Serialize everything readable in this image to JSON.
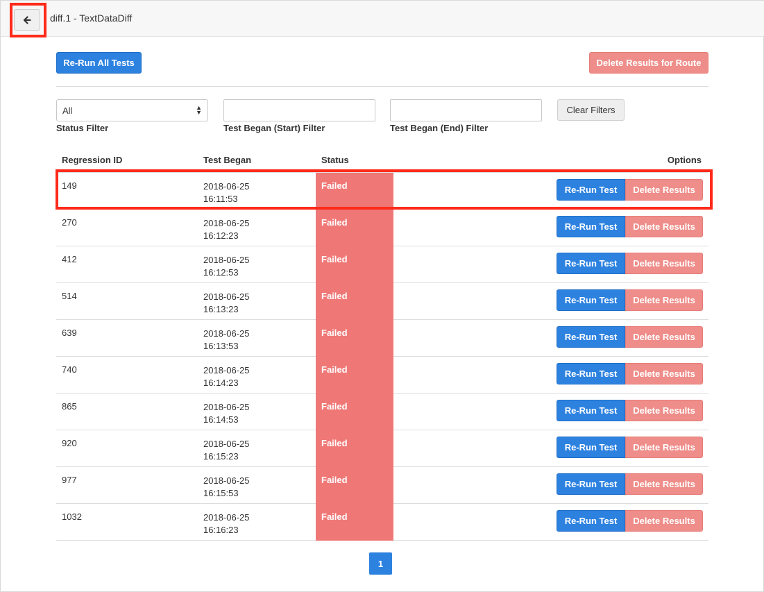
{
  "header": {
    "back_icon": "arrow-left-icon",
    "title": "diff.1 - TextDataDiff"
  },
  "toolbar": {
    "rerun_all_label": "Re-Run All Tests",
    "delete_route_label": "Delete Results for Route"
  },
  "filters": {
    "status_value": "All",
    "status_label": "Status Filter",
    "start_value": "",
    "start_label": "Test Began (Start) Filter",
    "end_value": "",
    "end_label": "Test Began (End) Filter",
    "clear_label": "Clear Filters"
  },
  "table": {
    "headers": {
      "id": "Regression ID",
      "began": "Test Began",
      "status": "Status",
      "options": "Options"
    },
    "rerun_label": "Re-Run Test",
    "delete_label": "Delete Results",
    "rows": [
      {
        "id": "149",
        "date": "2018-06-25",
        "time": "16:11:53",
        "status": "Failed"
      },
      {
        "id": "270",
        "date": "2018-06-25",
        "time": "16:12:23",
        "status": "Failed"
      },
      {
        "id": "412",
        "date": "2018-06-25",
        "time": "16:12:53",
        "status": "Failed"
      },
      {
        "id": "514",
        "date": "2018-06-25",
        "time": "16:13:23",
        "status": "Failed"
      },
      {
        "id": "639",
        "date": "2018-06-25",
        "time": "16:13:53",
        "status": "Failed"
      },
      {
        "id": "740",
        "date": "2018-06-25",
        "time": "16:14:23",
        "status": "Failed"
      },
      {
        "id": "865",
        "date": "2018-06-25",
        "time": "16:14:53",
        "status": "Failed"
      },
      {
        "id": "920",
        "date": "2018-06-25",
        "time": "16:15:23",
        "status": "Failed"
      },
      {
        "id": "977",
        "date": "2018-06-25",
        "time": "16:15:53",
        "status": "Failed"
      },
      {
        "id": "1032",
        "date": "2018-06-25",
        "time": "16:16:23",
        "status": "Failed"
      }
    ]
  },
  "pagination": {
    "current_page": "1"
  },
  "colors": {
    "primary": "#2d82e0",
    "danger": "#ee8d89",
    "failed": "#ef7877",
    "highlight": "#ff2a1a"
  }
}
